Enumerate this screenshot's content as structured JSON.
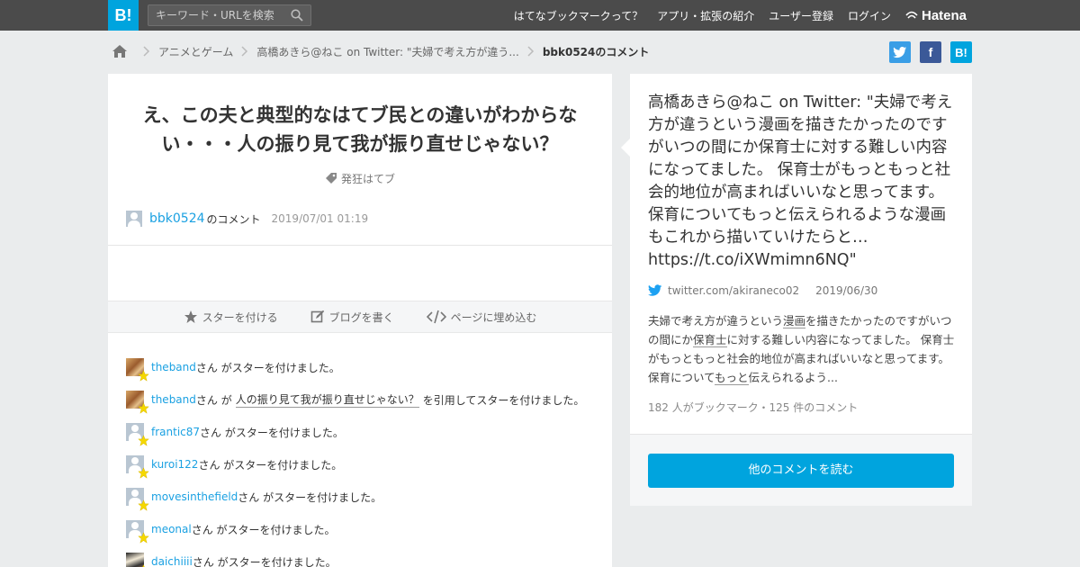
{
  "header": {
    "logo_text": "B!",
    "search_placeholder": "キーワード・URLを検索",
    "nav": [
      "はてなブックマークって？",
      "アプリ・拡張の紹介",
      "ユーザー登録",
      "ログイン"
    ],
    "brand": "Hatena"
  },
  "breadcrumb": {
    "items": [
      "アニメとゲーム",
      "高橋あきら@ねこ on Twitter: \"夫婦で考え方が違う...",
      "bbk0524のコメント"
    ]
  },
  "share": {
    "twitter": "t",
    "facebook": "f",
    "hatena": "B!"
  },
  "comment": {
    "text": "え、この夫と典型的なはてブ民との違いがわからない・・・人の振り見て我が振り直せじゃない？",
    "tag": "発狂はてブ",
    "user": "bbk0524",
    "user_suffix": "のコメント",
    "date": "2019/07/01 01:19"
  },
  "toolbar": {
    "star": "スターを付ける",
    "blog": "ブログを書く",
    "embed": "ページに埋め込む"
  },
  "stars": [
    {
      "user": "theband",
      "text": "さん がスターを付けました。",
      "avatar": "photo1"
    },
    {
      "user": "theband",
      "text_pre": "さん が",
      "quote": "人の振り見て我が振り直せじゃない？",
      "text_post": "を引用してスターを付けました。",
      "avatar": "photo1"
    },
    {
      "user": "frantic87",
      "text": "さん がスターを付けました。",
      "avatar": "default"
    },
    {
      "user": "kuroi122",
      "text": "さん がスターを付けました。",
      "avatar": "default"
    },
    {
      "user": "movesinthefield",
      "text": "さん がスターを付けました。",
      "avatar": "default"
    },
    {
      "user": "meonal",
      "text": "さん がスターを付けました。",
      "avatar": "default"
    },
    {
      "user": "daichiiii",
      "text": "さん がスターを付けました。",
      "avatar": "photo2"
    }
  ],
  "entry": {
    "title": "高橋あきら@ねこ on Twitter: \"夫婦で考え方が違うという漫画を描きたかったのですがいつの間にか保育士に対する難しい内容になってました。 保育士がもっともっと社会的地位が高まればいいなと思ってます。 保育についてもっと伝えられるような漫画もこれから描いていけたらと… https://t.co/iXWmimn6NQ\"",
    "source": "twitter.com/akiraneco02",
    "date": "2019/06/30",
    "desc_1": "夫婦で考え方が違うという",
    "desc_u1": "漫画",
    "desc_2": "を描きたかったのですがいつの間にか",
    "desc_u2": "保育士",
    "desc_3": "に対する難しい内容になってました。 保育士がもっともっと社会的地位が高まればいいなと思ってます。 保育について",
    "desc_u3": "もっと",
    "desc_4": "伝えられるよう...",
    "meta": "182 人がブックマーク・125 件のコメント",
    "button": "他のコメントを読む"
  },
  "colors": {
    "accent": "#00a4de",
    "header_bg": "#4b4b4b",
    "link": "#1ba1e2",
    "star": "#f5d800"
  }
}
